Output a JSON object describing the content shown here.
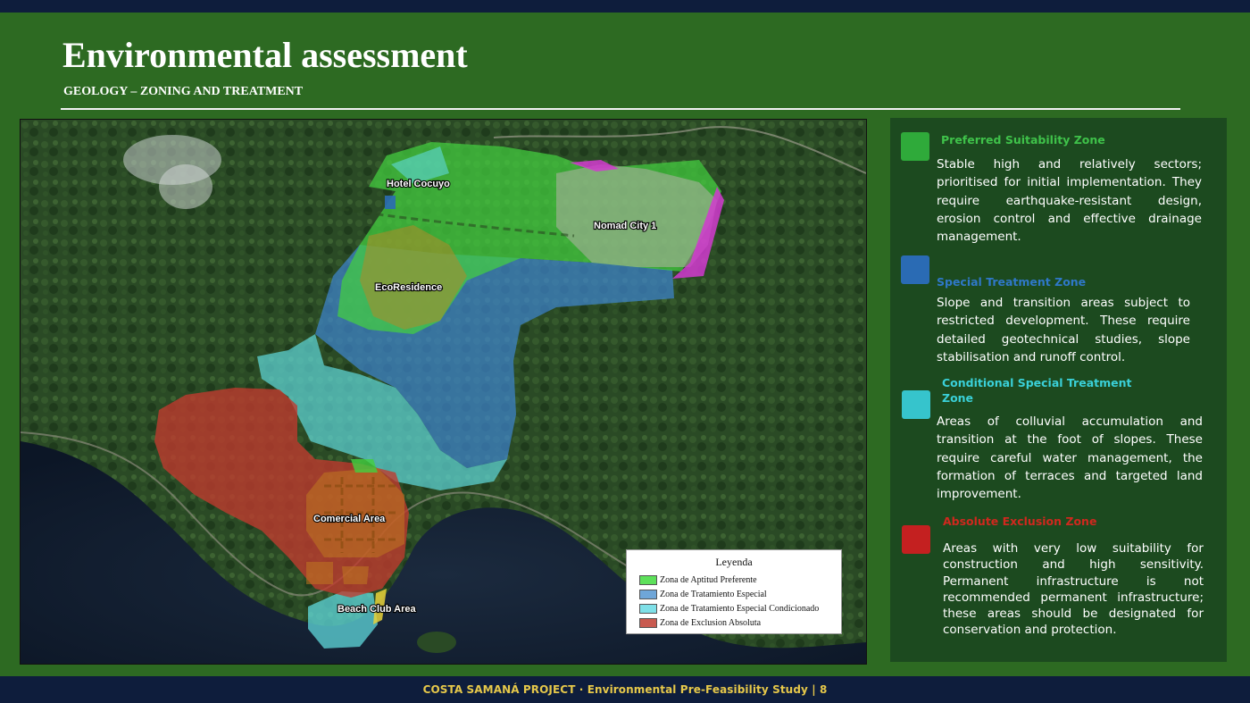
{
  "header": {
    "title": "Environmental assessment",
    "subtitle": "GEOLOGY – ZONING AND TREATMENT"
  },
  "map": {
    "labels": {
      "hotel": "Hotel Cocuyo",
      "nomad": "Nomad City 1",
      "eco": "EcoResidence",
      "comercial": "Comercial Area",
      "beach": "Beach Club Area"
    },
    "legend": {
      "title": "Leyenda",
      "items": [
        {
          "label": "Zona de Aptitud Preferente",
          "color": "#5de05a"
        },
        {
          "label": "Zona de Tratamiento Especial",
          "color": "#6fa6d8"
        },
        {
          "label": "Zona de Tratamiento Especial Condicionado",
          "color": "#7fe0e8"
        },
        {
          "label": "Zona de Exclusion Absoluta",
          "color": "#c85a50"
        }
      ]
    }
  },
  "zones": [
    {
      "title": "Preferred Suitability Zone",
      "color": "#2faa3a",
      "title_color": "#3fc24a",
      "body": "Stable high and relatively sectors; prioritised for initial implementation. They require earthquake-resistant design, erosion control and effective drainage management."
    },
    {
      "title": "Special Treatment Zone",
      "color": "#2a6bb4",
      "title_color": "#2f78c8",
      "body": "Slope and transition areas subject to restricted development. These require detailed geotechnical studies, slope stabilisation and runoff control."
    },
    {
      "title": "Conditional Special Treatment Zone",
      "color": "#36c4cc",
      "title_color": "#3ad0d8",
      "body": "Areas of colluvial accumulation and transition at the foot of slopes. These require careful water management, the formation of terraces and targeted land improvement."
    },
    {
      "title": "Absolute Exclusion Zone",
      "color": "#c42020",
      "title_color": "#d0281e",
      "body": "Areas with very low suitability for construction and high sensitivity. Permanent infrastructure is not recommended permanent infrastructure; these areas should be designated for conservation and protection."
    }
  ],
  "footer": {
    "text": "COSTA SAMANÁ PROJECT · Environmental Pre-Feasibility Study | 8"
  }
}
